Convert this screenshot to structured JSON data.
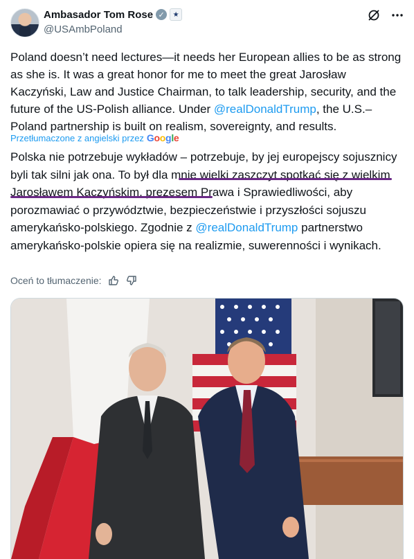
{
  "author": {
    "name": "Ambasador Tom Rose",
    "handle": "@USAmbPoland",
    "verified_mark": "✓",
    "seal_glyph": "★"
  },
  "header_icons": [
    "grok-icon",
    "more-icon"
  ],
  "tweet": {
    "part1": "Poland doesn’t need lectures—it needs her European allies to be as strong as she is. It was a great honor for me to meet the great Jarosław Kaczyński, Law and Justice Chairman, to talk leadership, security, and the future of the US-Polish alliance. Under ",
    "mention": "@realDonaldTrump",
    "part2": ", the U.S.–Poland partnership is built on realism, sovereignty, and results."
  },
  "translation": {
    "by_label": "Przetłumaczone z angielski przez",
    "provider": "Google",
    "part1": "Polska nie potrzebuje wykładów – potrzebuje, by jej europejscy sojusznicy byli tak silni jak ona. ",
    "highlighted": "To był dla mnie wielki zaszczyt spotkać się z wielkim Jarosławem Kaczyńskim",
    "part2": ", prezesem Prawa i Sprawiedliwości, aby porozmawiać o przywództwie, bezpieczeństwie i przyszłości sojuszu amerykańsko-polskiego. Zgodnie z ",
    "mention": "@realDonaldTrump",
    "part3": " partnerstwo amerykańsko-polskie opiera się na realizmie, suwerenności i wynikach.",
    "highlight_color": "#6b2a86"
  },
  "rate_translation": {
    "label": "Oceń to tłumaczenie:"
  },
  "photo": {
    "alt_subjects": [
      "polish-flag",
      "us-flag",
      "two-men"
    ]
  },
  "colors": {
    "link": "#1d9bf0",
    "text": "#0f1419",
    "muted": "#536471"
  }
}
